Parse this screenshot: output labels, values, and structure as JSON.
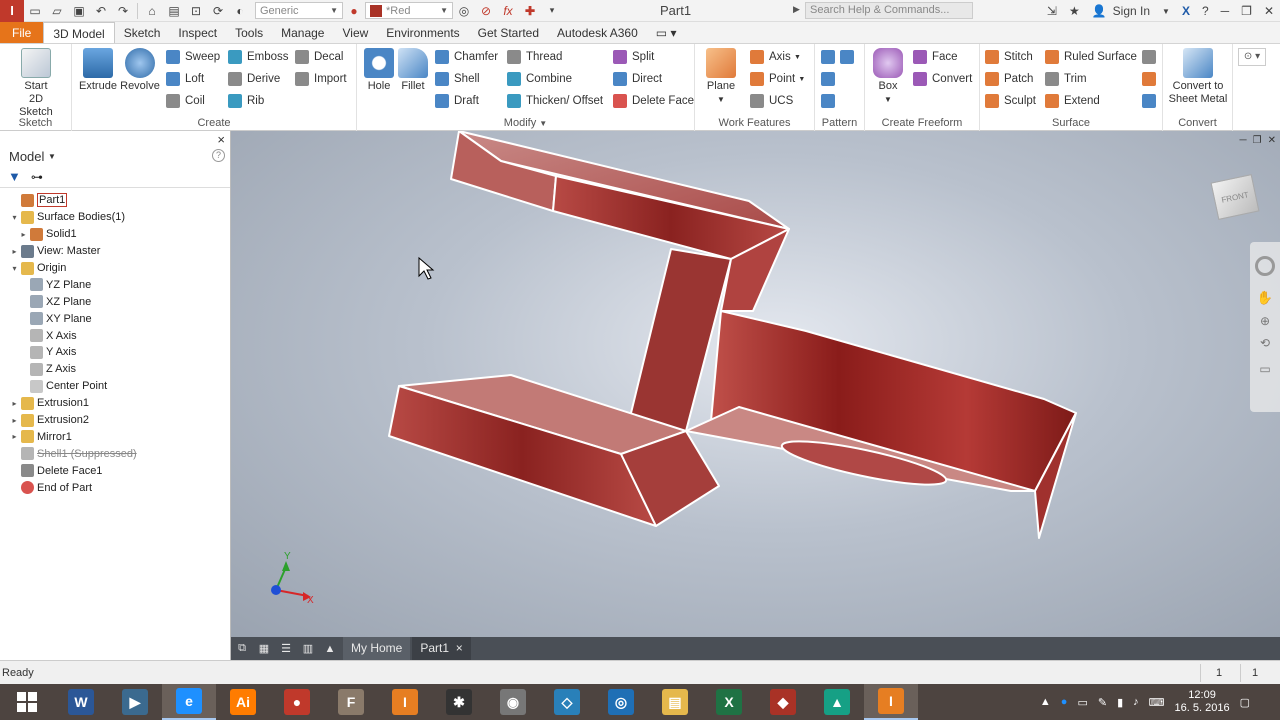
{
  "titlebar": {
    "app_letter": "I",
    "material": "Generic",
    "appearance": "*Red",
    "doc_title": "Part1",
    "search_placeholder": "Search Help & Commands...",
    "sign_in": "Sign In"
  },
  "tabs": [
    "File",
    "3D Model",
    "Sketch",
    "Inspect",
    "Tools",
    "Manage",
    "View",
    "Environments",
    "Get Started",
    "Autodesk A360"
  ],
  "ribbon": {
    "sketch": {
      "label": "Sketch",
      "start_line1": "Start",
      "start_line2": "2D Sketch"
    },
    "create": {
      "label": "Create",
      "extrude": "Extrude",
      "revolve": "Revolve",
      "sweep": "Sweep",
      "loft": "Loft",
      "coil": "Coil",
      "emboss": "Emboss",
      "derive": "Derive",
      "rib": "Rib",
      "decal": "Decal",
      "import": "Import"
    },
    "modify": {
      "label": "Modify",
      "hole": "Hole",
      "fillet": "Fillet",
      "chamfer": "Chamfer",
      "shell": "Shell",
      "draft": "Draft",
      "thread": "Thread",
      "combine": "Combine",
      "thicken": "Thicken/ Offset",
      "split": "Split",
      "direct": "Direct",
      "delete_face": "Delete Face"
    },
    "work_features": {
      "label": "Work Features",
      "plane": "Plane",
      "axis": "Axis",
      "point": "Point",
      "ucs": "UCS"
    },
    "pattern": {
      "label": "Pattern"
    },
    "freeform": {
      "label": "Create Freeform",
      "box": "Box",
      "face": "Face",
      "convert": "Convert"
    },
    "surface": {
      "label": "Surface",
      "stitch": "Stitch",
      "patch": "Patch",
      "sculpt": "Sculpt",
      "ruled": "Ruled Surface",
      "trim": "Trim",
      "extend": "Extend"
    },
    "convert": {
      "label": "Convert",
      "line1": "Convert to",
      "line2": "Sheet Metal"
    }
  },
  "browser": {
    "title": "Model",
    "close": "×",
    "tree": [
      {
        "label": "Part1",
        "depth": 0,
        "exp": "",
        "icon": "part",
        "boxed": true
      },
      {
        "label": "Surface Bodies(1)",
        "depth": 0,
        "exp": "▾",
        "icon": "folder"
      },
      {
        "label": "Solid1",
        "depth": 1,
        "exp": "▸",
        "icon": "solid"
      },
      {
        "label": "View: Master",
        "depth": 0,
        "exp": "▸",
        "icon": "view"
      },
      {
        "label": "Origin",
        "depth": 0,
        "exp": "▾",
        "icon": "folder"
      },
      {
        "label": "YZ Plane",
        "depth": 1,
        "exp": "",
        "icon": "plane"
      },
      {
        "label": "XZ Plane",
        "depth": 1,
        "exp": "",
        "icon": "plane"
      },
      {
        "label": "XY Plane",
        "depth": 1,
        "exp": "",
        "icon": "plane"
      },
      {
        "label": "X Axis",
        "depth": 1,
        "exp": "",
        "icon": "axis"
      },
      {
        "label": "Y Axis",
        "depth": 1,
        "exp": "",
        "icon": "axis"
      },
      {
        "label": "Z Axis",
        "depth": 1,
        "exp": "",
        "icon": "axis"
      },
      {
        "label": "Center Point",
        "depth": 1,
        "exp": "",
        "icon": "point"
      },
      {
        "label": "Extrusion1",
        "depth": 0,
        "exp": "▸",
        "icon": "extrude"
      },
      {
        "label": "Extrusion2",
        "depth": 0,
        "exp": "▸",
        "icon": "extrude-warn"
      },
      {
        "label": "Mirror1",
        "depth": 0,
        "exp": "▸",
        "icon": "mirror"
      },
      {
        "label": "Shell1 (Suppressed)",
        "depth": 0,
        "exp": "",
        "icon": "shell",
        "suppressed": true
      },
      {
        "label": "Delete Face1",
        "depth": 0,
        "exp": "",
        "icon": "delete"
      },
      {
        "label": "End of Part",
        "depth": 0,
        "exp": "",
        "icon": "end"
      }
    ]
  },
  "viewcube_label": "FRONT",
  "triad": {
    "x": "X",
    "y": "Y"
  },
  "doc_tabs": {
    "home": "My Home",
    "part": "Part1",
    "close": "×"
  },
  "status": {
    "text": "Ready",
    "n1": "1",
    "n2": "1"
  },
  "taskbar": {
    "apps": [
      {
        "name": "word",
        "letter": "W",
        "color": "#2b5797"
      },
      {
        "name": "movie-maker",
        "letter": "▶",
        "color": "#3b6a8f"
      },
      {
        "name": "internet-explorer",
        "letter": "e",
        "color": "#1e90ff",
        "active": true
      },
      {
        "name": "illustrator",
        "letter": "Ai",
        "color": "#ff7c00"
      },
      {
        "name": "popcorn",
        "letter": "●",
        "color": "#c0392b"
      },
      {
        "name": "inventor-fusion",
        "letter": "F",
        "color": "#8a7a6a"
      },
      {
        "name": "inventor-pro",
        "letter": "I",
        "color": "#e67e22"
      },
      {
        "name": "3ds-max",
        "letter": "✱",
        "color": "#333333"
      },
      {
        "name": "eye-app",
        "letter": "◉",
        "color": "#777777"
      },
      {
        "name": "box-app",
        "letter": "◇",
        "color": "#2980b9"
      },
      {
        "name": "camera-app",
        "letter": "◎",
        "color": "#1f6fb5"
      },
      {
        "name": "file-explorer",
        "letter": "▤",
        "color": "#e5b84c"
      },
      {
        "name": "excel",
        "letter": "X",
        "color": "#1f7244"
      },
      {
        "name": "red-cube",
        "letter": "◆",
        "color": "#a93226"
      },
      {
        "name": "teal-app",
        "letter": "▲",
        "color": "#16a085"
      },
      {
        "name": "inventor-active",
        "letter": "I",
        "color": "#e67e22",
        "active": true
      }
    ],
    "time": "12:09",
    "date": "16. 5. 2016"
  }
}
